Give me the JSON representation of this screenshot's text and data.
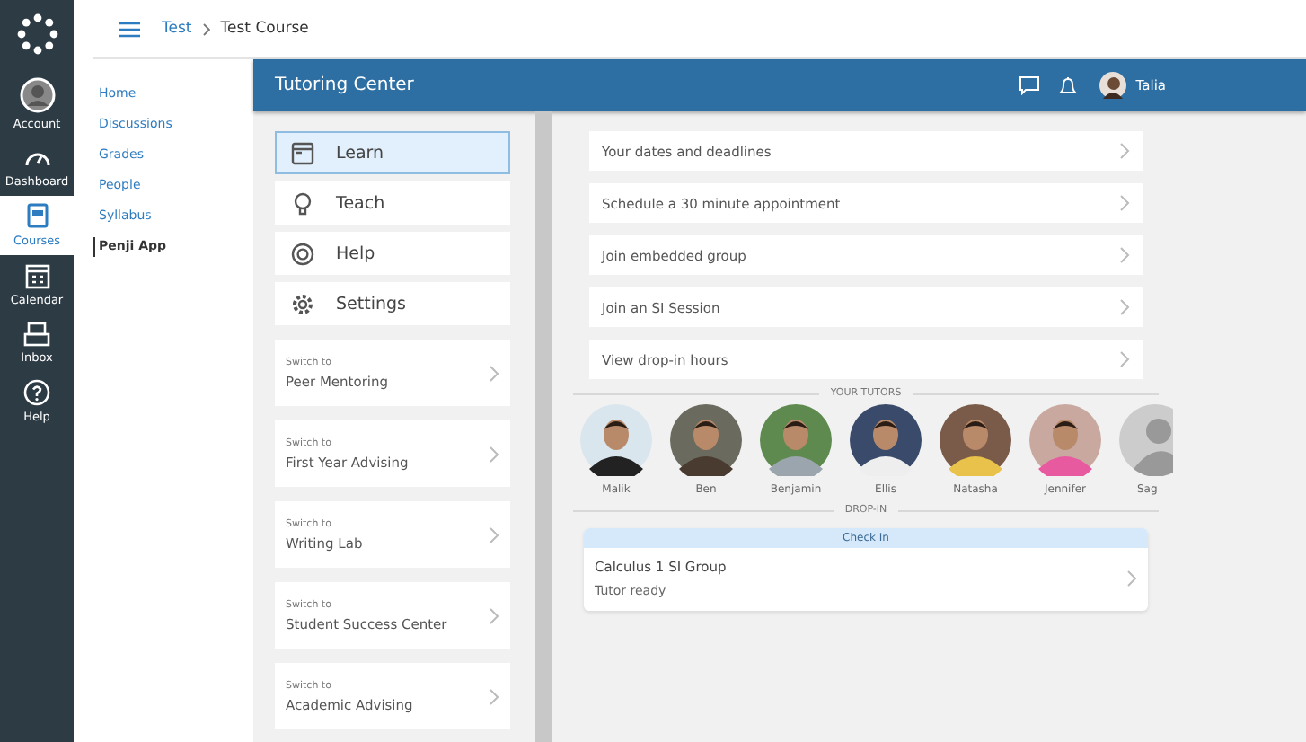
{
  "global_nav": [
    {
      "label": "Account",
      "selected": false
    },
    {
      "label": "Dashboard",
      "selected": false
    },
    {
      "label": "Courses",
      "selected": true
    },
    {
      "label": "Calendar",
      "selected": false
    },
    {
      "label": "Inbox",
      "selected": false
    },
    {
      "label": "Help",
      "selected": false
    }
  ],
  "breadcrumb": [
    {
      "label": "Test",
      "link": true
    },
    {
      "label": "Test Course",
      "link": false
    }
  ],
  "course_nav": [
    {
      "label": "Home",
      "selected": false
    },
    {
      "label": "Discussions",
      "selected": false
    },
    {
      "label": "Grades",
      "selected": false
    },
    {
      "label": "People",
      "selected": false
    },
    {
      "label": "Syllabus",
      "selected": false
    },
    {
      "label": "Penji App",
      "selected": true
    }
  ],
  "app": {
    "title": "Tutoring Center",
    "user": "Talia",
    "menu": [
      {
        "label": "Learn",
        "selected": true
      },
      {
        "label": "Teach",
        "selected": false
      },
      {
        "label": "Help",
        "selected": false
      },
      {
        "label": "Settings",
        "selected": false
      }
    ],
    "switches": [
      {
        "caption": "Switch to",
        "label": "Peer Mentoring"
      },
      {
        "caption": "Switch to",
        "label": "First Year Advising"
      },
      {
        "caption": "Switch to",
        "label": "Writing Lab"
      },
      {
        "caption": "Switch to",
        "label": "Student Success Center"
      },
      {
        "caption": "Switch to",
        "label": "Academic Advising"
      }
    ],
    "actions": [
      "Your dates and deadlines",
      "Schedule a 30 minute appointment",
      "Join embedded group",
      "Join an SI Session",
      "View drop-in hours"
    ],
    "tutors_heading": "YOUR TUTORS",
    "tutors": [
      {
        "name": "Malik"
      },
      {
        "name": "Ben"
      },
      {
        "name": "Benjamin"
      },
      {
        "name": "Ellis"
      },
      {
        "name": "Natasha"
      },
      {
        "name": "Jennifer"
      },
      {
        "name": "Sag",
        "kind": "placeholder"
      }
    ],
    "dropin_heading": "DROP-IN",
    "dropin": {
      "banner": "Check In",
      "title": "Calculus 1 SI Group",
      "status": "Tutor ready"
    }
  }
}
